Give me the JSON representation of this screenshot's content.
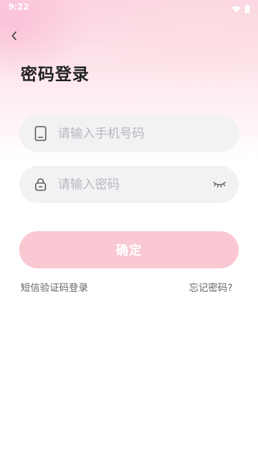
{
  "status_bar": {
    "time": "9:22",
    "icons": [
      "wifi-icon",
      "battery-icon"
    ]
  },
  "header": {
    "back_icon": "chevron-left-icon",
    "title": "密码登录"
  },
  "form": {
    "phone": {
      "icon": "phone-icon",
      "placeholder": "请输入手机号码",
      "value": ""
    },
    "password": {
      "icon": "lock-icon",
      "placeholder": "请输入密码",
      "value": "",
      "toggle_icon": "eye-closed-icon"
    },
    "confirm_label": "确定"
  },
  "links": {
    "sms_login": "短信验证码登录",
    "forgot_password": "忘记密码?"
  },
  "colors": {
    "accent": "#f9c8d3",
    "field_bg": "#f2f2f4",
    "placeholder": "#b8b8bd",
    "link_text": "#666666"
  }
}
